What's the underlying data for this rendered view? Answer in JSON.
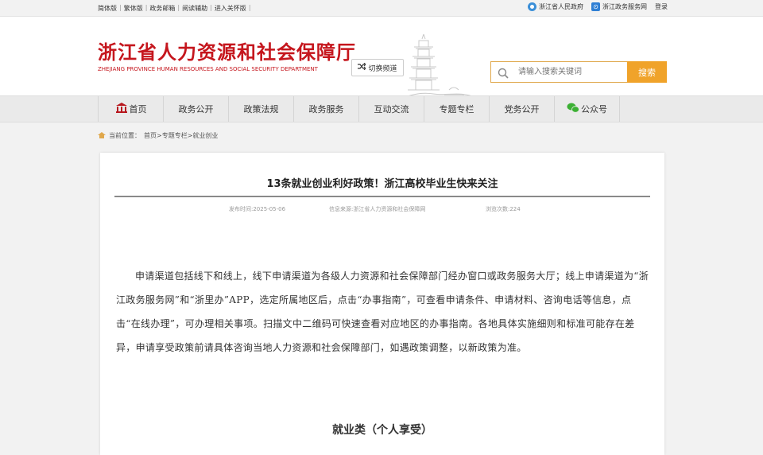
{
  "topbar": {
    "links": [
      "简体版",
      "繁体版",
      "政务邮箱",
      "阅读辅助",
      "进入关怀版"
    ],
    "right": {
      "gov_site": "浙江省人民政府",
      "service_site": "浙江政务服务网",
      "login": "登录"
    }
  },
  "header": {
    "title_cn": "浙江省人力资源和社会保障厅",
    "title_en": "ZHEJIANG PROVINCE HUMAN RESOURCES AND SOCIAL SECURITY DEPARTMENT",
    "switch_label": "切换频道",
    "search_placeholder": "请输入搜索关键词",
    "search_button": "搜索"
  },
  "nav": {
    "items": [
      "首页",
      "政务公开",
      "政策法规",
      "政务服务",
      "互动交流",
      "专题专栏",
      "党务公开",
      "公众号"
    ]
  },
  "breadcrumb": {
    "label": "当前位置：",
    "path": "首页>专题专栏>就业创业"
  },
  "article": {
    "title": "13条就业创业利好政策！浙江高校毕业生快来关注",
    "publish_date": "发布时间:2025-05-06",
    "source": "信息来源:浙江省人力资源和社会保障网",
    "views": "浏览次数:224",
    "paragraph": "申请渠道包括线下和线上，线下申请渠道为各级人力资源和社会保障部门经办窗口或政务服务大厅；线上申请渠道为“浙江政务服务网”和“浙里办”APP，选定所属地区后，点击“办事指南”，可查看申请条件、申请材料、咨询电话等信息，点击“在线办理”，可办理相关事项。扫描文中二维码可快速查看对应地区的办事指南。各地具体实施细则和标准可能存在差异，申请享受政策前请具体咨询当地人力资源和社会保障部门，如遇政策调整，以新政策为准。",
    "section_heading": "就业类（个人享受）"
  },
  "colors": {
    "brand_red": "#c5161d",
    "accent_orange": "#f0a32a"
  }
}
